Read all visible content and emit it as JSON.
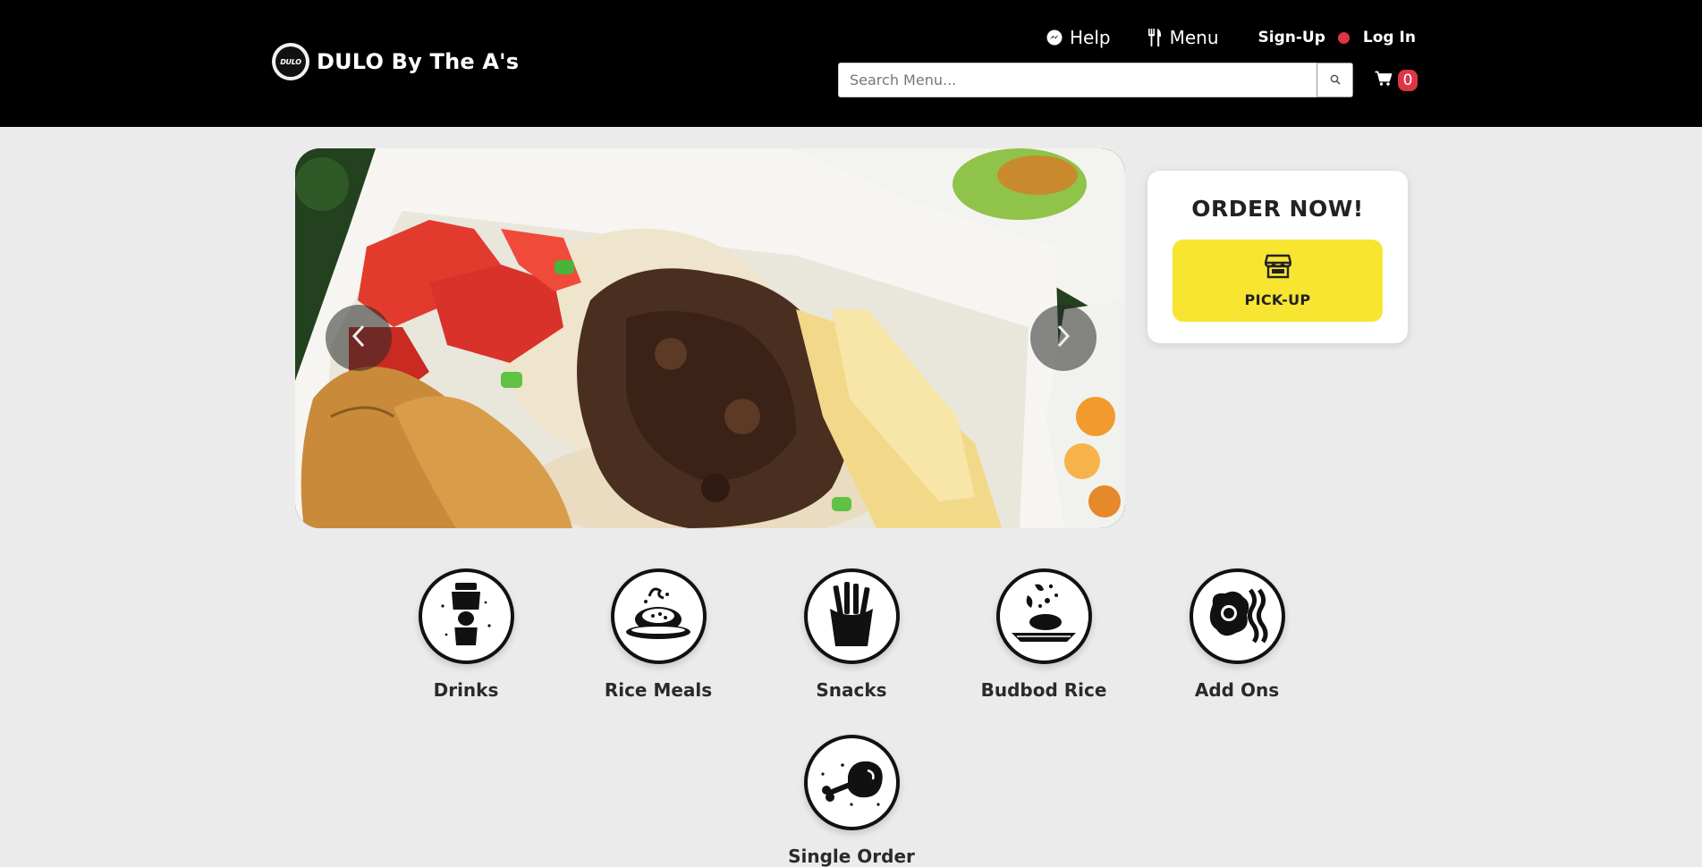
{
  "header": {
    "brand_title": "DULO By The A's",
    "logo_text": "DULO",
    "nav": {
      "help": "Help",
      "menu": "Menu"
    },
    "auth": {
      "signup": "Sign-Up",
      "login": "Log In"
    },
    "search": {
      "placeholder": "Search Menu...",
      "value": ""
    },
    "cart": {
      "count": "0"
    }
  },
  "order": {
    "title": "ORDER NOW!",
    "pickup_label": "PICK-UP"
  },
  "categories": [
    {
      "label": "Drinks",
      "icon": "drink-cup-icon"
    },
    {
      "label": "Rice Meals",
      "icon": "rice-plate-icon"
    },
    {
      "label": "Snacks",
      "icon": "fries-icon"
    },
    {
      "label": "Budbod Rice",
      "icon": "budbod-rice-icon"
    },
    {
      "label": "Add Ons",
      "icon": "egg-bacon-icon"
    },
    {
      "label": "Single Order",
      "icon": "chicken-leg-icon"
    }
  ],
  "colors": {
    "header_bg": "#000000",
    "page_bg": "#ebebeb",
    "accent_yellow": "#f7e532",
    "badge_red": "#dc3545"
  }
}
